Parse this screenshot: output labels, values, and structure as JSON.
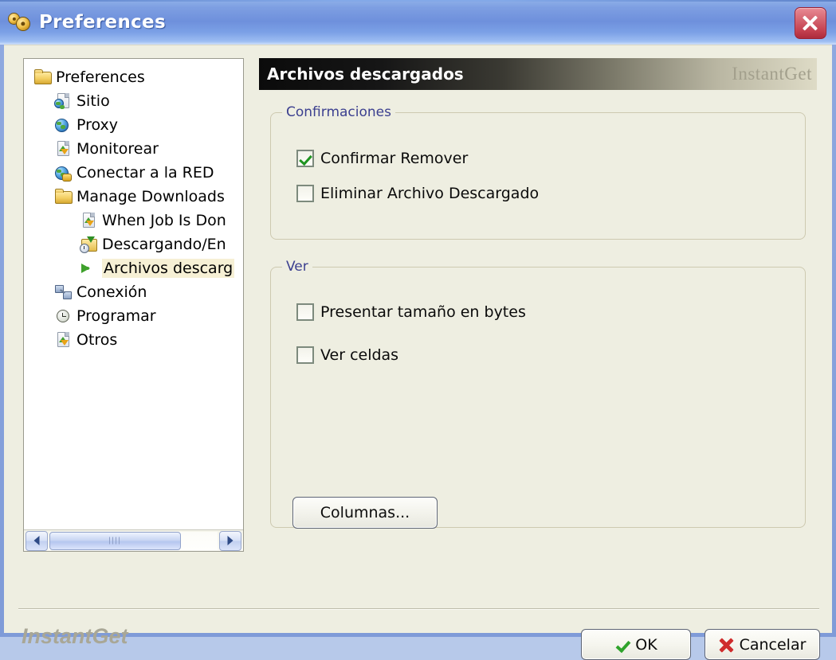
{
  "window": {
    "title": "Preferences",
    "title_icon": "gears-icon",
    "close_icon": "close-icon"
  },
  "tree": {
    "items": [
      {
        "label": "Preferences",
        "icon": "folder-icon",
        "indent": 0,
        "selected": false
      },
      {
        "label": "Sitio",
        "icon": "document-globe-icon",
        "indent": 1,
        "selected": false
      },
      {
        "label": "Proxy",
        "icon": "globe-icon",
        "indent": 1,
        "selected": false
      },
      {
        "label": "Monitorear",
        "icon": "document-recycle-icon",
        "indent": 1,
        "selected": false
      },
      {
        "label": "Conectar a la RED",
        "icon": "globe-key-icon",
        "indent": 1,
        "selected": false
      },
      {
        "label": "Manage Downloads",
        "icon": "folder-icon",
        "indent": 1,
        "selected": false
      },
      {
        "label": "When Job Is Don",
        "icon": "document-recycle-icon",
        "indent": 2,
        "selected": false
      },
      {
        "label": "Descargando/En",
        "icon": "download-folder-icon",
        "indent": 2,
        "selected": false
      },
      {
        "label": "Archivos descarg",
        "icon": "green-arrow-icon",
        "indent": 2,
        "selected": true
      },
      {
        "label": "Conexión",
        "icon": "connection-icon",
        "indent": 1,
        "selected": false
      },
      {
        "label": "Programar",
        "icon": "clock-icon",
        "indent": 1,
        "selected": false
      },
      {
        "label": "Otros",
        "icon": "document-recycle-icon",
        "indent": 1,
        "selected": false
      }
    ],
    "scrollbar": {
      "left_arrow_icon": "chevron-left-icon",
      "right_arrow_icon": "chevron-right-icon",
      "thumb_grip_icon": "grip-icon"
    }
  },
  "panel": {
    "title": "Archivos descargados",
    "brand": "InstantGet",
    "groups": [
      {
        "legend": "Confirmaciones",
        "checkboxes": [
          {
            "label": "Confirmar Remover",
            "checked": true
          },
          {
            "label": "Eliminar Archivo Descargado",
            "checked": false
          }
        ]
      },
      {
        "legend": "Ver",
        "checkboxes": [
          {
            "label": "Presentar tamaño en bytes",
            "checked": false
          },
          {
            "label": "Ver celdas",
            "checked": false
          }
        ]
      }
    ],
    "columnas_button": "Columnas..."
  },
  "footer": {
    "brand": "InstantGet",
    "ok_label": "OK",
    "ok_icon": "green-check-icon",
    "cancel_label": "Cancelar",
    "cancel_icon": "red-cross-icon"
  },
  "colors": {
    "titlebar_blue": "#7e9fe2",
    "client_background": "#eeeee1",
    "legend_text": "#3b3f8f",
    "selection": "#f6f0d5",
    "accent_green": "#2fa32b",
    "accent_red": "#cf2c2c",
    "brand_gray": "#a9a796"
  }
}
